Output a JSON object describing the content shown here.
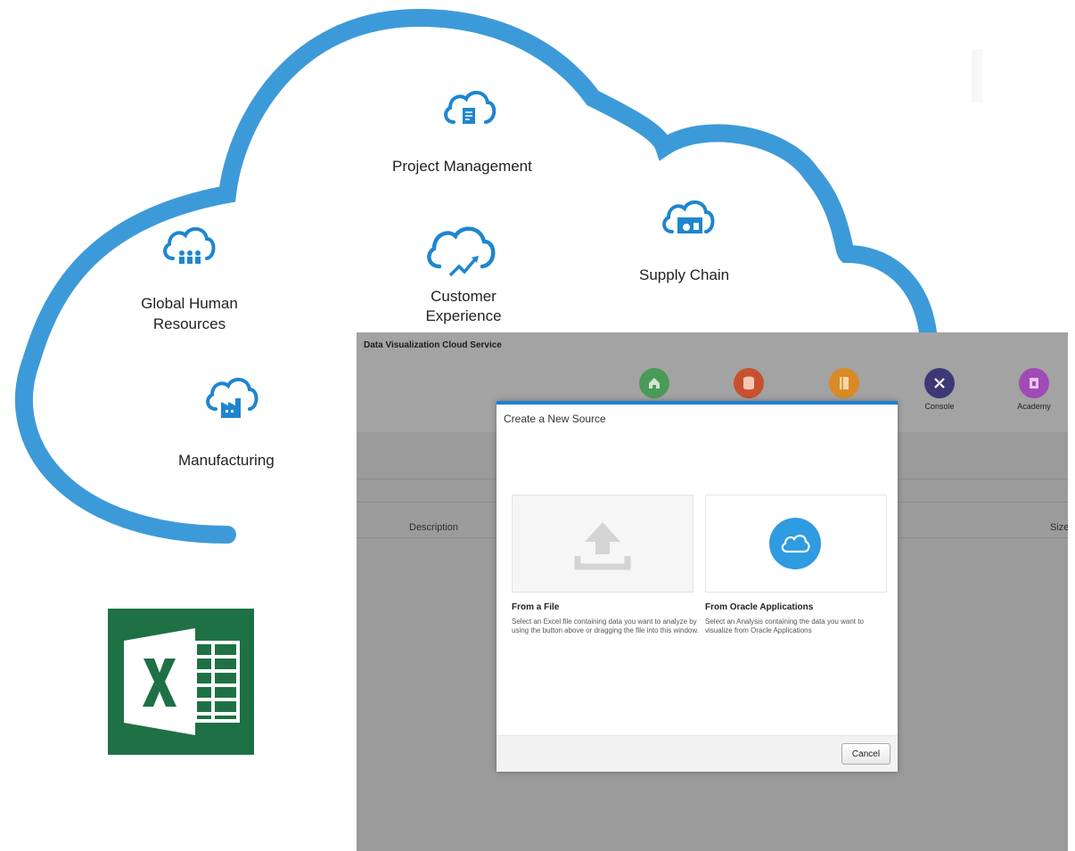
{
  "cloud": {
    "project_management": "Project Management",
    "supply_chain": "Supply Chain",
    "global_human_resources": [
      "Global Human",
      "Resources"
    ],
    "customer_experience": [
      "Customer",
      "Experience"
    ],
    "manufacturing": "Manufacturing"
  },
  "app": {
    "title": "Data Visualization Cloud Service",
    "nav": [
      {
        "label": "",
        "color": "#4a9a58",
        "icon": "home-icon"
      },
      {
        "label": "",
        "color": "#c7512f",
        "icon": "database-icon"
      },
      {
        "label": "",
        "color": "#d98a25",
        "icon": "book-icon"
      },
      {
        "label": "Console",
        "color": "#3e3976",
        "icon": "tools-icon"
      },
      {
        "label": "Academy",
        "color": "#a04bb5",
        "icon": "academy-icon"
      }
    ],
    "columns": {
      "description": "Description",
      "size": "Size"
    }
  },
  "dialog": {
    "title": "Create a New Source",
    "file": {
      "title": "From a File",
      "desc": "Select an Excel file containing data you want to analyze by using the button above or dragging the file into this window."
    },
    "oracle": {
      "title": "From Oracle Applications",
      "desc": "Select an Analysis containing the data you want to visualize from Oracle Applications"
    },
    "cancel_label": "Cancel"
  },
  "colors": {
    "cloud_blue": "#3d9ad9",
    "accent_blue": "#1f7fd1",
    "excel_green": "#1e7145"
  }
}
